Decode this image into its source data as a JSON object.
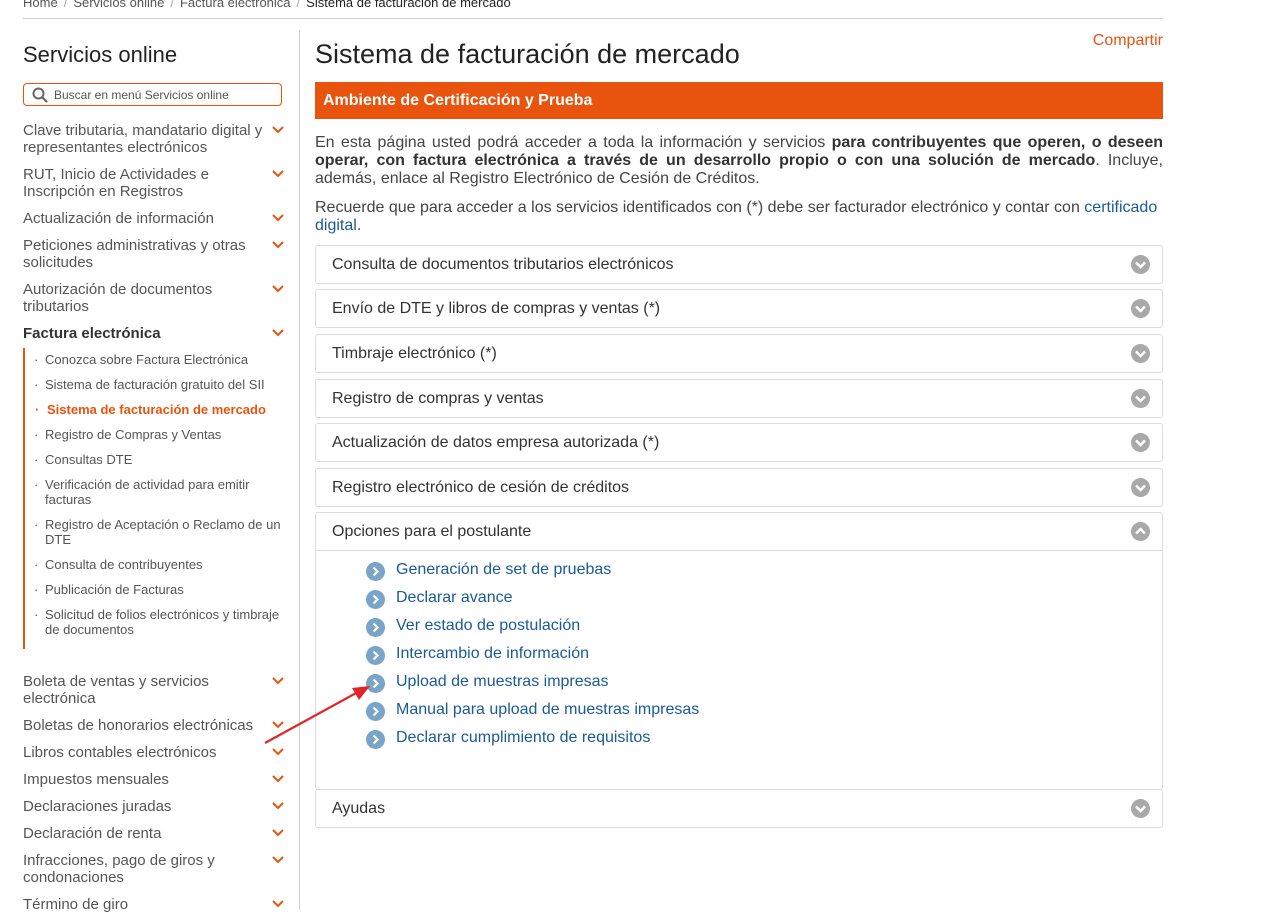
{
  "breadcrumb": {
    "items": [
      "Home",
      "Servicios online",
      "Factura electrónica"
    ],
    "current": "Sistema de facturación de mercado"
  },
  "sidebar": {
    "title": "Servicios online",
    "search_placeholder": "Buscar en menú Servicios online",
    "items_top": [
      "Clave tributaria, mandatario digital y representantes electrónicos",
      "RUT, Inicio de Actividades e Inscripción en Registros",
      "Actualización de información",
      "Peticiones administrativas y otras solicitudes",
      "Autorización de documentos tributarios"
    ],
    "active_item": "Factura electrónica",
    "subitems": [
      "Conozca sobre Factura Electrónica",
      "Sistema de facturación gratuito del SII",
      "Sistema de facturación de mercado",
      "Registro de Compras y Ventas",
      "Consultas DTE",
      "Verificación de actividad para emitir facturas",
      "Registro de Aceptación o Reclamo de un DTE",
      "Consulta de contribuyentes",
      "Publicación de Facturas",
      "Solicitud de folios electrónicos y timbraje de documentos"
    ],
    "items_bottom": [
      "Boleta de ventas y servicios electrónica",
      "Boletas de honorarios electrónicas",
      "Libros contables electrónicos",
      "Impuestos mensuales",
      "Declaraciones juradas",
      "Declaración de renta",
      "Infracciones, pago de giros y condonaciones",
      "Término de giro"
    ]
  },
  "main": {
    "share": "Compartir",
    "title": "Sistema de facturación de mercado",
    "banner": "Ambiente de Certificación y Prueba",
    "intro_start": "En esta página usted podrá acceder a toda la información y servicios ",
    "intro_bold": "para contribuyentes que operen, o deseen operar, con factura electrónica a través de un desarrollo propio o con una solución de mercado",
    "intro_end": ". Incluye, además, enlace al Registro Electrónico de Cesión de Créditos.",
    "note_start": "Recuerde que para acceder a los servicios identificados con (*) debe ser facturador electrónico y contar con ",
    "note_link": "certificado digital",
    "note_end": ".",
    "accordions": [
      "Consulta de documentos tributarios electrónicos",
      "Envío de DTE y libros de compras y ventas (*)",
      "Timbraje electrónico (*)",
      "Registro de compras y ventas",
      "Actualización de datos empresa autorizada (*)",
      "Registro electrónico de cesión de créditos",
      "Opciones para el postulante",
      "Ayudas"
    ],
    "postulante_options": [
      "Generación de set de pruebas",
      "Declarar avance",
      "Ver estado de postulación",
      "Intercambio de información",
      "Upload de muestras impresas",
      "Manual para upload de muestras impresas",
      "Declarar cumplimiento de requisitos"
    ]
  },
  "colors": {
    "accent": "#e8540e",
    "link": "#1a5a99",
    "annotation_arrow": "#e0262b"
  }
}
